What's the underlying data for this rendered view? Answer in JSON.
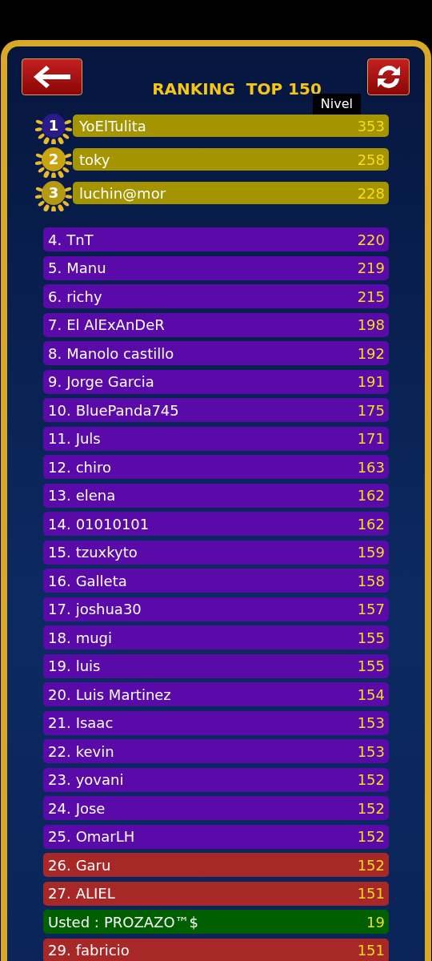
{
  "header": {
    "title": "RANKING  TOP 150",
    "column_label": "Nivel"
  },
  "podium": [
    {
      "rank": "1",
      "name": "YoElTulita",
      "level_value": "353",
      "color": "#2a1a8a"
    },
    {
      "rank": "2",
      "name": "toky",
      "level_value": "258",
      "color": "#c9a410"
    },
    {
      "rank": "3",
      "name": "luchin@mor",
      "level_value": "228",
      "color": "#b49a10"
    }
  ],
  "rows": [
    {
      "kind": "rank",
      "rank": "4.",
      "name": "TnT",
      "level_value": "220",
      "color": "#5a0aa8"
    },
    {
      "kind": "rank",
      "rank": "5.",
      "name": "Manu",
      "level_value": "219",
      "color": "#5a0aa8"
    },
    {
      "kind": "rank",
      "rank": "6.",
      "name": "richy",
      "level_value": "215",
      "color": "#5a0aa8"
    },
    {
      "kind": "rank",
      "rank": "7.",
      "name": "El AlExAnDeR",
      "level_value": "198",
      "color": "#5a0aa8"
    },
    {
      "kind": "rank",
      "rank": "8.",
      "name": "Manolo castillo",
      "level_value": "192",
      "color": "#5a0aa8"
    },
    {
      "kind": "rank",
      "rank": "9.",
      "name": "Jorge Garcia",
      "level_value": "191",
      "color": "#5a0aa8"
    },
    {
      "kind": "rank",
      "rank": "10.",
      "name": "BluePanda745",
      "level_value": "175",
      "color": "#5a0aa8"
    },
    {
      "kind": "rank",
      "rank": "11.",
      "name": "Juls",
      "level_value": "171",
      "color": "#5a0aa8"
    },
    {
      "kind": "rank",
      "rank": "12.",
      "name": "chiro",
      "level_value": "163",
      "color": "#5a0aa8"
    },
    {
      "kind": "rank",
      "rank": "13.",
      "name": "elena",
      "level_value": "162",
      "color": "#5a0aa8"
    },
    {
      "kind": "rank",
      "rank": "14.",
      "name": "01010101",
      "level_value": "162",
      "color": "#5a0aa8"
    },
    {
      "kind": "rank",
      "rank": "15.",
      "name": "tzuxkyto",
      "level_value": "159",
      "color": "#5a0aa8"
    },
    {
      "kind": "rank",
      "rank": "16.",
      "name": "Galleta",
      "level_value": "158",
      "color": "#5a0aa8"
    },
    {
      "kind": "rank",
      "rank": "17.",
      "name": "joshua30",
      "level_value": "157",
      "color": "#5a0aa8"
    },
    {
      "kind": "rank",
      "rank": "18.",
      "name": "mugi",
      "level_value": "155",
      "color": "#5a0aa8"
    },
    {
      "kind": "rank",
      "rank": "19.",
      "name": "luis",
      "level_value": "155",
      "color": "#5a0aa8"
    },
    {
      "kind": "rank",
      "rank": "20.",
      "name": "Luis Martinez",
      "level_value": "154",
      "color": "#5a0aa8"
    },
    {
      "kind": "rank",
      "rank": "21.",
      "name": "Isaac",
      "level_value": "153",
      "color": "#5a0aa8"
    },
    {
      "kind": "rank",
      "rank": "22.",
      "name": "kevin",
      "level_value": "153",
      "color": "#5a0aa8"
    },
    {
      "kind": "rank",
      "rank": "23.",
      "name": "yovani",
      "level_value": "152",
      "color": "#5a0aa8"
    },
    {
      "kind": "rank",
      "rank": "24.",
      "name": "Jose",
      "level_value": "152",
      "color": "#5a0aa8"
    },
    {
      "kind": "rank",
      "rank": "25.",
      "name": "OmarLH",
      "level_value": "152",
      "color": "#5a0aa8"
    },
    {
      "kind": "rank",
      "rank": "26.",
      "name": "Garu",
      "level_value": "152",
      "color": "#a82828"
    },
    {
      "kind": "rank",
      "rank": "27.",
      "name": "ALIEL",
      "level_value": "151",
      "color": "#a82828"
    },
    {
      "kind": "self",
      "label": "Usted :",
      "name": "PROZAZO™$",
      "level_value": "19",
      "color": "#006000"
    },
    {
      "kind": "rank",
      "rank": "29.",
      "name": "fabricio",
      "level_value": "151",
      "color": "#a82828"
    }
  ]
}
